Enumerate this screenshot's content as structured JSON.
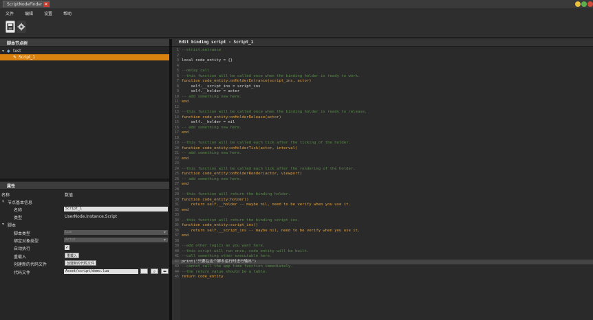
{
  "window": {
    "tab_title": "ScriptNodeFinder",
    "tab_close": "✕",
    "controls": [
      {
        "name": "minimize-button",
        "color": "#e8c23a"
      },
      {
        "name": "maximize-button",
        "color": "#5bb04a"
      },
      {
        "name": "close-button",
        "color": "#d24a3a"
      }
    ]
  },
  "menu": [
    "文件",
    "编辑",
    "设置",
    "帮助"
  ],
  "toolbar": {
    "save_icon": "save-icon",
    "settings_icon": "gear-icon"
  },
  "tree": {
    "header": "脚本节点树",
    "root_label": "test",
    "child_label": "Script_1"
  },
  "properties": {
    "header": "属性",
    "col_name": "名称",
    "col_value": "数值",
    "group_basic": "节点基本信息",
    "name_label": "名称",
    "name_value": "Script_1",
    "type_label": "类型",
    "type_value": "UserNode.Instance.Script",
    "group_script": "脚本",
    "script_type_label": "脚本类型",
    "script_type_value": "Lua",
    "bind_type_label": "绑定对象类型",
    "bind_type_value": "Actor",
    "autorun_label": "自动执行",
    "autorun_value": "✓",
    "reload_label": "重载入",
    "reload_button": "重载入",
    "create_label": "创建新的代码文件",
    "create_button": "创建新的代码文件",
    "codefile_label": "代码文件",
    "codefile_value": "Asset/script/demo.lua"
  },
  "editor": {
    "title": "Edit binding script - Script_1",
    "lines": [
      {
        "n": "1",
        "t": "--strict.entrance",
        "c": "#5a8a4a"
      },
      {
        "n": "2",
        "t": "",
        "c": "#d8d8d8"
      },
      {
        "n": "3",
        "t": "local code_entity = {}",
        "c": "#d8d8d8"
      },
      {
        "n": "4",
        "t": "",
        "c": "#d8d8d8"
      },
      {
        "n": "5",
        "t": "--delay call",
        "c": "#5a8a4a"
      },
      {
        "n": "6",
        "t": "--this function will be called once when the binding holder is ready to work.",
        "c": "#5a8a4a"
      },
      {
        "n": "7",
        "t": "function code_entity:onHolderEntrance(script_ins, actor)",
        "c": "#e0a040"
      },
      {
        "n": "8",
        "t": "    self.__script_ins = script_ins",
        "c": "#d8d8d8"
      },
      {
        "n": "9",
        "t": "    self.__holder = actor",
        "c": "#d8d8d8"
      },
      {
        "n": "10",
        "t": "-- add something new here.",
        "c": "#5a8a4a"
      },
      {
        "n": "11",
        "t": "end",
        "c": "#e0a040"
      },
      {
        "n": "12",
        "t": "",
        "c": "#d8d8d8"
      },
      {
        "n": "13",
        "t": "--this function will be called once when the binding holder is ready to release.",
        "c": "#5a8a4a"
      },
      {
        "n": "14",
        "t": "function code_entity:onHolderRelease(actor)",
        "c": "#e0a040"
      },
      {
        "n": "15",
        "t": "    self.__holder = nil",
        "c": "#d8d8d8"
      },
      {
        "n": "16",
        "t": "-- add something new here.",
        "c": "#5a8a4a"
      },
      {
        "n": "17",
        "t": "end",
        "c": "#e0a040"
      },
      {
        "n": "18",
        "t": "",
        "c": "#d8d8d8"
      },
      {
        "n": "19",
        "t": "--this function will be called each tick after the ticking of the holder.",
        "c": "#5a8a4a"
      },
      {
        "n": "20",
        "t": "function code_entity:onHolderTick(actor, interval)",
        "c": "#e0a040"
      },
      {
        "n": "21",
        "t": "-- add something new here.",
        "c": "#5a8a4a"
      },
      {
        "n": "22",
        "t": "end",
        "c": "#e0a040"
      },
      {
        "n": "23",
        "t": "",
        "c": "#d8d8d8"
      },
      {
        "n": "24",
        "t": "--this function will be called each tick after the rendering of the holder.",
        "c": "#5a8a4a"
      },
      {
        "n": "25",
        "t": "function code_entity:onHolderRender(actor, viewport)",
        "c": "#e0a040"
      },
      {
        "n": "26",
        "t": "-- add something new here.",
        "c": "#5a8a4a"
      },
      {
        "n": "27",
        "t": "end",
        "c": "#e0a040"
      },
      {
        "n": "28",
        "t": "",
        "c": "#d8d8d8"
      },
      {
        "n": "29",
        "t": "--this function will return the binding holder.",
        "c": "#5a8a4a"
      },
      {
        "n": "30",
        "t": "function code_entity:holder()",
        "c": "#e0a040"
      },
      {
        "n": "31",
        "t": "    return self.__holder -- maybe nil, need to be verify when you use it.",
        "c": "#e0a040"
      },
      {
        "n": "32",
        "t": "end",
        "c": "#e0a040"
      },
      {
        "n": "33",
        "t": "",
        "c": "#d8d8d8"
      },
      {
        "n": "34",
        "t": "--this function will return the binding script_ins.",
        "c": "#5a8a4a"
      },
      {
        "n": "35",
        "t": "function code_entity:script_ins()",
        "c": "#e0a040"
      },
      {
        "n": "36",
        "t": "    return self.__script_ins -- maybe nil, need to be verify when you use it.",
        "c": "#e0a040"
      },
      {
        "n": "37",
        "t": "end",
        "c": "#e0a040"
      },
      {
        "n": "38",
        "t": "",
        "c": "#d8d8d8"
      },
      {
        "n": "39",
        "t": "--add other logics as you want here.",
        "c": "#5a8a4a"
      },
      {
        "n": "40",
        "t": "--this script will run once, code_entity will be built.",
        "c": "#5a8a4a"
      },
      {
        "n": "41",
        "t": "--call something other executable here.",
        "c": "#5a8a4a"
      },
      {
        "n": "42",
        "t": "print(\"只要在这个脚本运行时进行输出\")",
        "c": "#d8d8d8",
        "hl": true
      },
      {
        "n": "43",
        "t": "--cannot call the app time function immediately.",
        "c": "#5a8a4a"
      },
      {
        "n": "44",
        "t": "--the return value should be a table.",
        "c": "#5a8a4a"
      },
      {
        "n": "45",
        "t": "return code_entity",
        "c": "#e0a040"
      }
    ]
  }
}
